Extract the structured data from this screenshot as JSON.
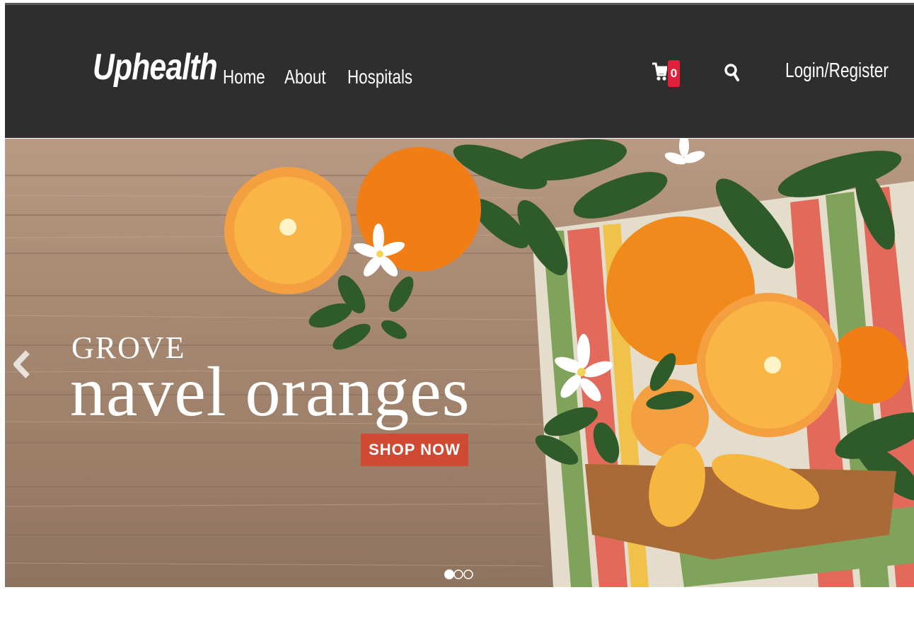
{
  "navbar": {
    "brand": "Uphealth",
    "links": [
      "Home",
      "About",
      "Hospitals"
    ],
    "cart_count": "0",
    "login_label": "Login/Register",
    "icons": [
      "cart-icon",
      "search-icon"
    ]
  },
  "hero": {
    "line1": "GROVE",
    "line2": "navel oranges",
    "cta_label": "SHOP NOW",
    "slide_count": 3,
    "active_slide": 1
  },
  "colors": {
    "navbar_bg": "#2e2e2e",
    "badge": "#e0213b",
    "cta": "#d04a33",
    "orange": "#f08a1c"
  }
}
